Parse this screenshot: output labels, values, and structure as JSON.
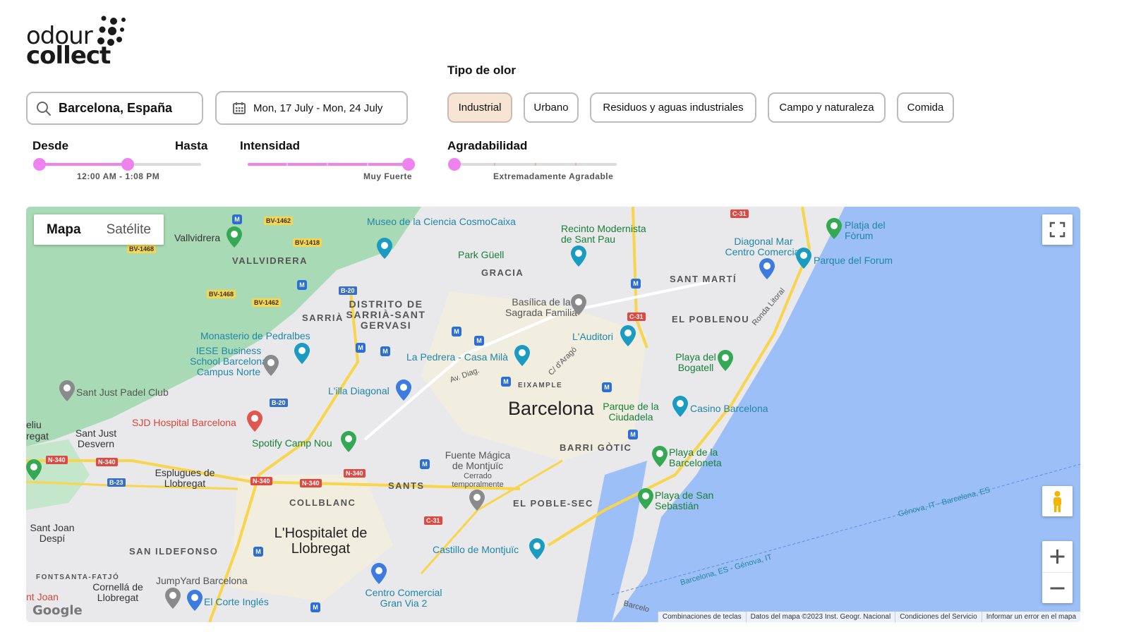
{
  "brand": {
    "line1": "odour",
    "line2": "collect"
  },
  "search": {
    "value": "Barcelona, España"
  },
  "dates": {
    "value": "Mon, 17 July - Mon, 24 July"
  },
  "odor_type": {
    "label": "Tipo de olor",
    "chips": [
      {
        "label": "Industrial",
        "active": true
      },
      {
        "label": "Urbano",
        "active": false
      },
      {
        "label": "Residuos y aguas industriales",
        "active": false
      },
      {
        "label": "Campo y naturaleza",
        "active": false
      },
      {
        "label": "Comida",
        "active": false
      }
    ]
  },
  "time_slider": {
    "from_label": "Desde",
    "to_label": "Hasta",
    "value_text": "12:00 AM - 1:08 PM",
    "start": 0.0,
    "end": 0.535
  },
  "intensity": {
    "label": "Intensidad",
    "value_text": "Muy Fuerte",
    "value": 1.0
  },
  "pleasantness": {
    "label": "Agradabilidad",
    "value_text": "Extremadamente Agradable",
    "value": 0.0
  },
  "map": {
    "type_buttons": {
      "map": "Mapa",
      "satellite": "Satélite"
    },
    "city": "Barcelona",
    "labels": [
      "Museo de la Ciencia CosmoCaixa",
      "Recinto Modernista de Sant Pau",
      "Platja del Fòrum",
      "Diagonal Mar Centro Comercial",
      "Parque del Forum",
      "Park Güell",
      "GRACIA",
      "SANT MARTÍ",
      "VALLVIDRERA",
      "Vallvidrera",
      "Basílica de la Sagrada Familia",
      "EL POBLENOU",
      "Ronda Litoral",
      "DISTRITO DE SARRIÀ-SANT GERVASI",
      "SARRIÀ",
      "Monasterio de Pedralbes",
      "L'Auditori",
      "IESE Business School Barcelona Campus Norte",
      "La Pedrera - Casa Milà",
      "Playa del Bogatell",
      "Sant Just Padel Club",
      "L'illa Diagonal",
      "EIXAMPLE",
      "Av. Diag.",
      "C/ d'Aragó",
      "Parque de la Ciudadela",
      "Casino Barcelona",
      "SJD Hospital Barcelona",
      "Sant Just Desvern",
      "eliu",
      "regat",
      "Spotify Camp Nou",
      "BARRI GÒTIC",
      "Fuente Mágica de Montjuïc",
      "Cerrado temporalmente",
      "Playa de la Barceloneta",
      "Esplugues de Llobregat",
      "SANTS",
      "COLLBLANC",
      "EL POBLE-SEC",
      "Playa de San Sebastián",
      "Sant Joan Despí",
      "L'Hospitalet de Llobregat",
      "SAN ILDEFONSO",
      "Castillo de Montjuïc",
      "Génova, IT - Barcelona, ES",
      "Barcelona, ES - Génova, IT",
      "FONTSANTA-FATJÓ",
      "Cornellá de Llobregat",
      "JumpYard Barcelona",
      "El Corte Inglés",
      "Centro Comercial Gran Via 2",
      "nt Joan",
      "Barcelo"
    ],
    "road_shields": [
      "BV-1462",
      "BV-1418",
      "BV-1468",
      "BV-1468",
      "BV-1462",
      "B-20",
      "B-20",
      "C-31",
      "C-31",
      "C-31",
      "N-340",
      "N-340",
      "N-340",
      "N-340",
      "N-340",
      "B-23"
    ],
    "footer": [
      "Combinaciones de teclas",
      "Datos del mapa ©2023 Inst. Geogr. Nacional",
      "Condiciones del Servicio",
      "Informar un error en el mapa"
    ],
    "google_logo": "Google"
  },
  "colors": {
    "accent": "#ee82ee",
    "chip_active": "#f8e4d2",
    "sea": "#9cbff7",
    "park": "#a8dab5",
    "road": "#f8d54a"
  }
}
